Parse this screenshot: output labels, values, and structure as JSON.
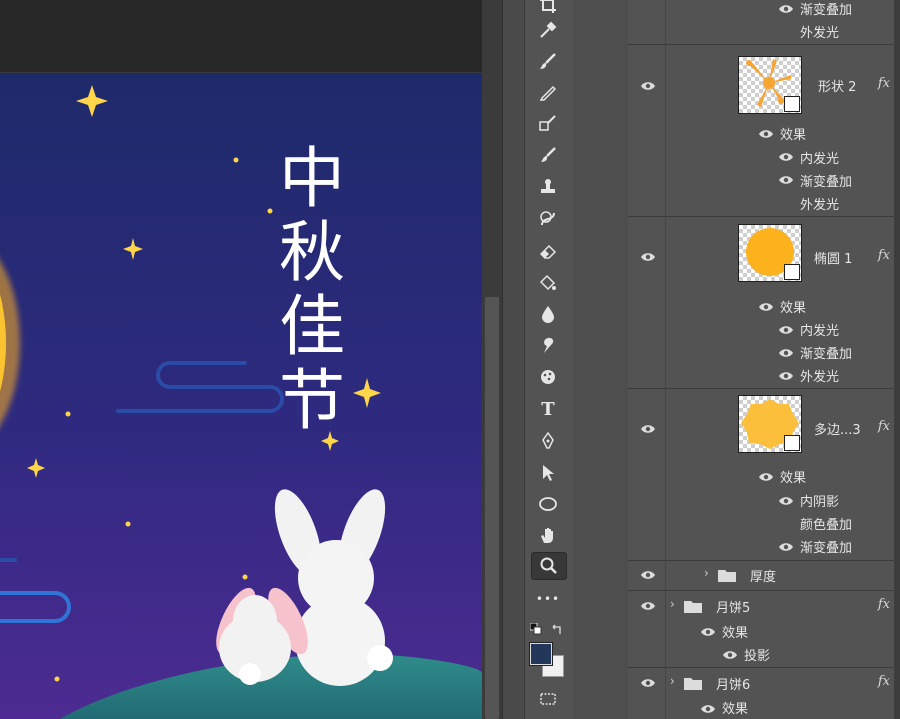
{
  "layers_panel": {
    "top_group": {
      "effects": [
        "渐变叠加",
        "外发光"
      ]
    },
    "layers": [
      {
        "name": "形状 2",
        "fx": "fx",
        "effects_label": "效果",
        "effects": [
          "内发光",
          "渐变叠加",
          "外发光"
        ],
        "thumb_color": "#f6a531"
      },
      {
        "name": "椭圆 1",
        "fx": "fx",
        "effects_label": "效果",
        "effects": [
          "内发光",
          "渐变叠加",
          "外发光"
        ],
        "thumb_color": "#fbb21d"
      },
      {
        "name": "多边...3",
        "fx": "fx",
        "effects_label": "效果",
        "effects": [
          "内阴影",
          "颜色叠加",
          "渐变叠加"
        ],
        "thumb_color": "#fbbf3b"
      }
    ],
    "groups": [
      {
        "name": "厚度",
        "fx": ""
      },
      {
        "name": "月饼5",
        "fx": "fx",
        "effects_label": "效果",
        "effects": [
          "投影"
        ]
      },
      {
        "name": "月饼6",
        "fx": "fx",
        "effects_label": "效果",
        "effects": []
      }
    ]
  },
  "canvas": {
    "title_chars": [
      "中",
      "秋",
      "佳",
      "节"
    ],
    "colors": {
      "sky_top": "#1f2a6b",
      "sky_bottom": "#4a2a8f",
      "moon": "#fbc531",
      "star": "#ffd24d",
      "hill": "#2f8a8e"
    }
  },
  "toolbar": {
    "tools": [
      "crop-icon",
      "eyedropper-icon",
      "brush-icon",
      "pencil-icon",
      "clone-stamp-icon",
      "history-brush-icon",
      "stamp-icon",
      "spot-heal-icon",
      "eraser-icon",
      "paint-bucket-icon",
      "blur-icon",
      "smudge-icon",
      "sponge-icon",
      "type-tool-icon",
      "pen-icon",
      "select-arrow-icon",
      "ellipse-icon",
      "hand-icon",
      "zoom-icon",
      "more-tools-icon"
    ],
    "type_glyph": "T",
    "more_glyph": "•••",
    "foreground_color": "#23375a",
    "background_color": "#f0f0f0"
  }
}
